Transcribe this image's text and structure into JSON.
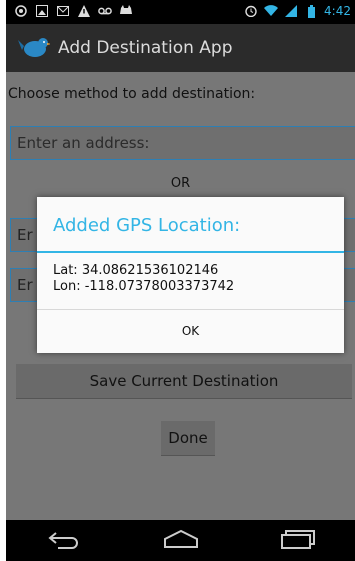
{
  "status_bar": {
    "time": "4:42",
    "left_icons": [
      "location-icon",
      "image-icon",
      "gmail-icon",
      "warning-icon",
      "voicemail-icon",
      "cat-icon"
    ],
    "right_icons": [
      "alarm-icon",
      "wifi-icon",
      "signal-icon",
      "battery-icon"
    ]
  },
  "action_bar": {
    "title": "Add Destination App"
  },
  "main": {
    "prompt": "Choose method to add destination:",
    "address_input": {
      "placeholder": "Enter an address:"
    },
    "or_label": "OR",
    "field2_partial": "Er",
    "field3_partial": "Er",
    "save_button": "Save Current Destination",
    "done_button": "Done"
  },
  "dialog": {
    "title": "Added GPS Location:",
    "lat_line": "Lat: 34.08621536102146",
    "lon_line": "Lon: -118.07378003373742",
    "ok_label": "OK"
  },
  "colors": {
    "accent": "#33b5e5",
    "actionbar": "#2b2b2b",
    "content_dim": "#777777"
  }
}
